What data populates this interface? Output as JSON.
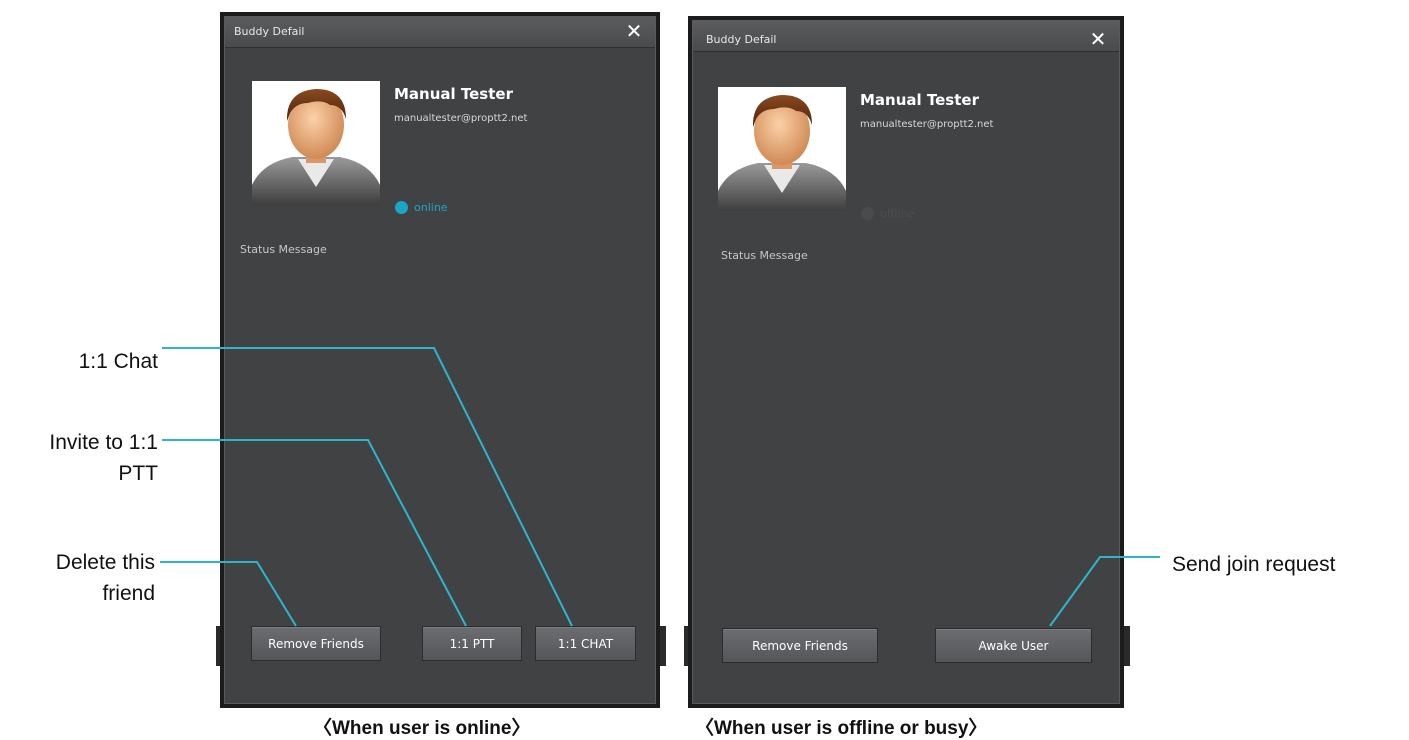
{
  "online_panel": {
    "title": "Buddy Defail",
    "close_glyph": "✕",
    "name": "Manual Tester",
    "email": "manualtester@proptt2.net",
    "status": "online",
    "status_color": "#1ba6c8",
    "status_message_label": "Status Message",
    "buttons": {
      "remove": "Remove Friends",
      "ptt": "1:1 PTT",
      "chat": "1:1 CHAT"
    }
  },
  "offline_panel": {
    "title": "Buddy Defail",
    "close_glyph": "✕",
    "name": "Manual Tester",
    "email": "manualtester@proptt2.net",
    "status": "offline",
    "status_color": "#4a4b4e",
    "status_message_label": "Status Message",
    "buttons": {
      "remove": "Remove Friends",
      "awake": "Awake User"
    }
  },
  "annotations": {
    "chat": "1:1 Chat",
    "ptt_line1": "Invite to 1:1",
    "ptt_line2": "PTT",
    "delete_line1": "Delete this",
    "delete_line2": "friend",
    "join": "Send join request"
  },
  "captions": {
    "online": "〈When user is online〉",
    "offline": "〈When user is offline or busy〉"
  },
  "colors": {
    "leader_line": "#2fb5cb",
    "panel_bg": "#414244",
    "online_accent": "#1ba6c8"
  },
  "icons": {
    "close": "close-icon",
    "avatar": "user-avatar-icon",
    "status": "status-dot-icon"
  }
}
